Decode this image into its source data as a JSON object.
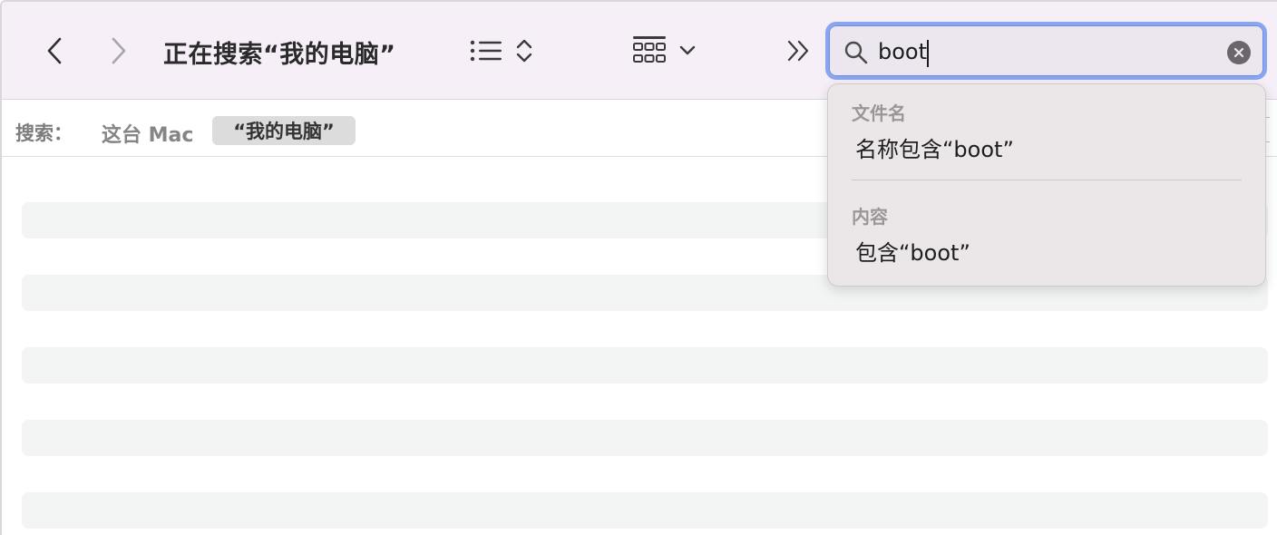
{
  "toolbar": {
    "title": "正在搜索“我的电脑”",
    "icons": {
      "back": "chevron-left-icon",
      "forward": "chevron-right-icon",
      "list": "list-view-icon",
      "sort": "up-down-chevron-icon",
      "grid": "icon-grid-view-icon",
      "grid_menu": "chevron-down-icon",
      "more": "double-chevron-right-icon"
    }
  },
  "search": {
    "value": "boot",
    "placeholder": "",
    "icon": "magnifier-icon",
    "clear_icon": "clear-x-icon"
  },
  "scope": {
    "label": "搜索：",
    "this_mac": "这台 Mac",
    "my_computer": "“我的电脑”"
  },
  "suggestions": {
    "filename_header": "文件名",
    "filename_item": "名称包含“boot”",
    "content_header": "内容",
    "content_item": "包含“boot”"
  },
  "colors": {
    "toolbar_bg": "#f6eff8",
    "focus_ring": "#8aa6f0",
    "popover_bg": "#ebe6e8",
    "row_bg": "#f3f4f4"
  }
}
